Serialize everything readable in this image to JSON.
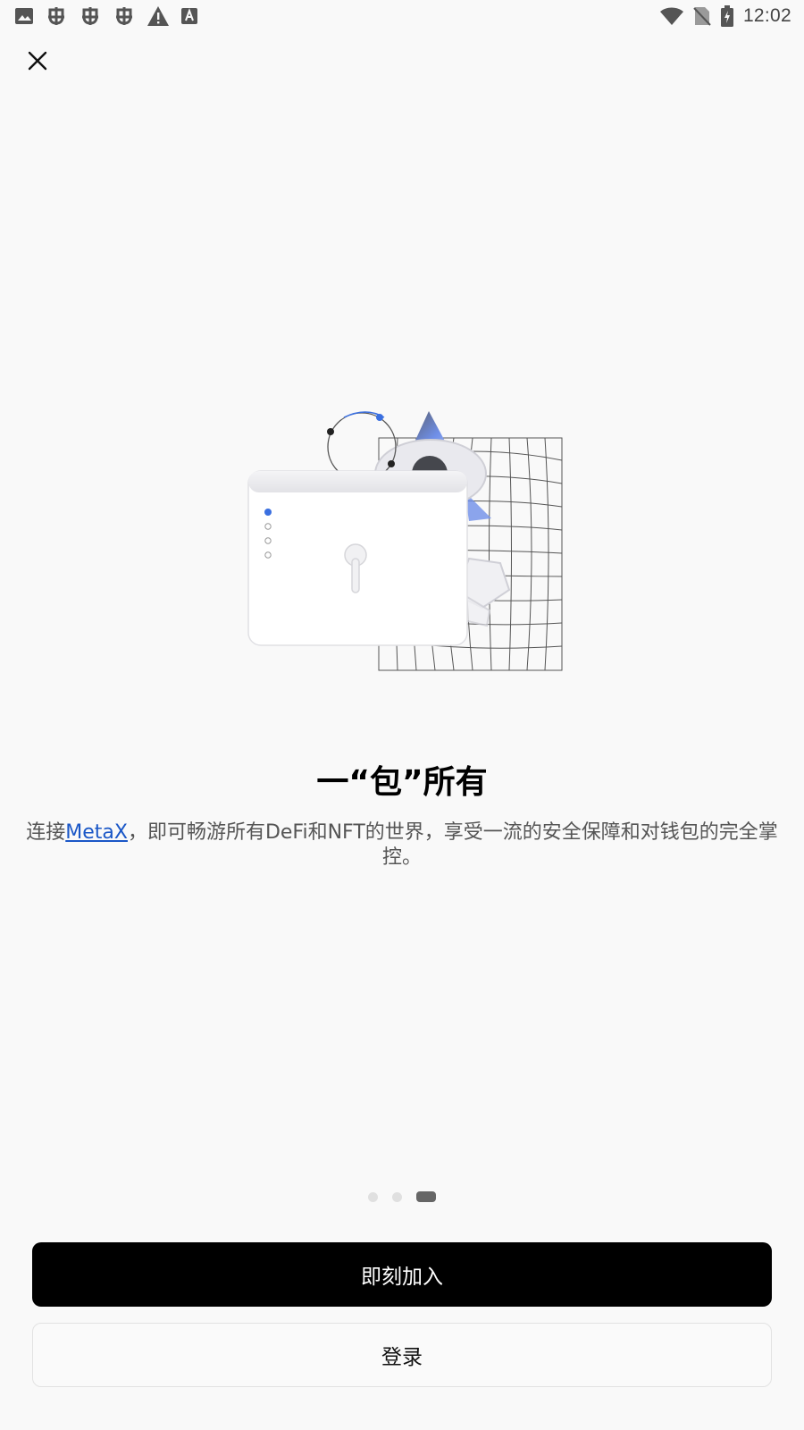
{
  "status_bar": {
    "time": "12:02",
    "left_icons": [
      "image-icon",
      "bug-icon",
      "bug-icon",
      "bug-icon",
      "warning-icon",
      "font-a-icon"
    ],
    "right_icons": [
      "wifi-icon",
      "no-sim-icon",
      "battery-charging-icon"
    ]
  },
  "close": {
    "icon": "close-icon"
  },
  "hero": {
    "title": "一“包”所有",
    "description_prefix": "连接",
    "description_link": "MetaX",
    "description_suffix": "，即可畅游所有DeFi和NFT的世界，享受一流的安全保障和对钱包的完全掌控。"
  },
  "pager": {
    "total": 3,
    "current": 3
  },
  "buttons": {
    "primary_label": "即刻加入",
    "secondary_label": "登录"
  },
  "colors": {
    "background": "#f9f9f9",
    "primary_button": "#000000",
    "link": "#1a57c7",
    "accent_blue": "#3a6fe0"
  }
}
